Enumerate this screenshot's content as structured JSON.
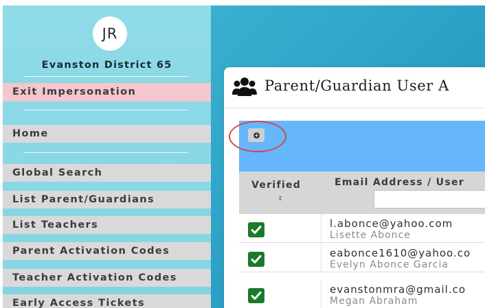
{
  "sidebar": {
    "avatar_initials": "JR",
    "district_name": "Evanston District 65",
    "exit_label": "Exit Impersonation",
    "items": [
      {
        "label": "Home"
      },
      {
        "label": "Global Search"
      },
      {
        "label": "List Parent/Guardians"
      },
      {
        "label": "List Teachers"
      },
      {
        "label": "Parent Activation Codes"
      },
      {
        "label": "Teacher Activation Codes"
      },
      {
        "label": "Early Access Tickets"
      }
    ]
  },
  "main": {
    "title": "Parent/Guardian User A",
    "title_icon": "users-icon",
    "add_button_icon": "plus-circle-icon",
    "table": {
      "headers": {
        "verified": "Verified",
        "email": "Email Address / User"
      },
      "sort_icon": "⇕",
      "email_filter_value": "",
      "rows": [
        {
          "verified": true,
          "email": "l.abonce@yahoo.com",
          "name": "Lisette Abonce"
        },
        {
          "verified": true,
          "email": "eabonce1610@yahoo.co",
          "name": "Evelyn Abonce Garcia"
        },
        {
          "verified": true,
          "email": "evanstonmra@gmail.co",
          "name": "Megan Abraham"
        }
      ]
    }
  },
  "colors": {
    "sidebar_bg": "#8fdbe8",
    "nav_item_bg": "#d9d9d9",
    "exit_bg": "#f4c6ce",
    "main_bg": "#2a9fc4",
    "toolbar_bg": "#66b6fb",
    "check_green": "#1b7a2a",
    "highlight_ring": "#cf4a47"
  }
}
